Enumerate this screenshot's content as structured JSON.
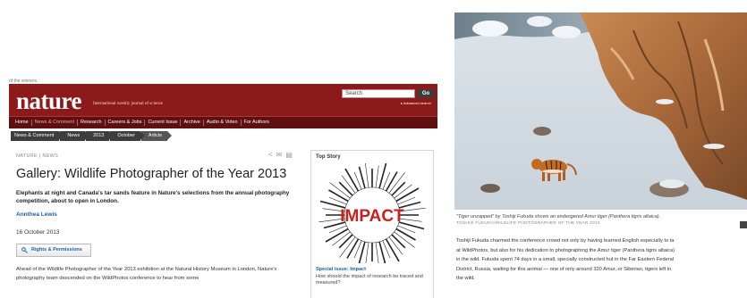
{
  "left": {
    "top_snippet": "of the winners.",
    "masthead": {
      "logo": "nature",
      "tagline": "International weekly journal of science",
      "search_placeholder": "Search",
      "go_label": "Go",
      "advanced_search": "▸ Advanced search"
    },
    "nav": [
      {
        "label": "Home",
        "active": false
      },
      {
        "label": "News & Comment",
        "active": true
      },
      {
        "label": "Research",
        "active": false
      },
      {
        "label": "Careers & Jobs",
        "active": false
      },
      {
        "label": "Current Issue",
        "active": false
      },
      {
        "label": "Archive",
        "active": false
      },
      {
        "label": "Audio & Video",
        "active": false
      },
      {
        "label": "For Authors",
        "active": false
      }
    ],
    "breadcrumbs": [
      "News & Comment",
      "News",
      "2013",
      "October",
      "Article"
    ],
    "article": {
      "section": "NATURE | NEWS",
      "title": "Gallery: Wildlife Photographer of the Year 2013",
      "standfirst": "Elephants at night and Canada's tar sands feature in Nature's selections from the annual photography competition, about to open in London.",
      "author": "Annthea Lewis",
      "date": "16 October 2013",
      "rights_button": "Rights & Permissions",
      "body": "Ahead of the Wildlife Photographer of the Year 2013 exhibition at the Natural History Museum in London, Nature's photography team descended on the WildPhotos conference to hear from some"
    },
    "sidebar": {
      "label": "Top Story",
      "art_word": "IMPACT",
      "link": "Special issue: Impact",
      "description": "How should the impact of research be traced and measured?"
    }
  },
  "right": {
    "caption": "\"Tiger unzapped\" by Toshiji Fukuda shows an endangered Amur tiger (Panthera tigris altaica).",
    "credit": "TOSHIJI FUKUDA/WILDLIFE PHOTOGRAPHER OF THE YEAR 2013",
    "body_lines": [
      "Toshiji Fukuda charmed the conference crowd not only by having learned English especially to ta",
      "at WildPhotos, but also for his dedication to photographing the Amur tiger (Panthera tigris altaica)",
      "in the wild. Fukuda spent 74 days in a small, specially constructed hut in the Far Eastern Federal",
      "District, Russia, waiting for this animal — one of only around 320 Amur, or Siberian, tigers left in",
      "the wild."
    ]
  },
  "colors": {
    "masthead": "#8c1a1a",
    "nav": "#5f0f0f",
    "breadcrumb": "#3d3d3d",
    "link": "#1c63a8",
    "impact_red": "#cc1f1f"
  }
}
